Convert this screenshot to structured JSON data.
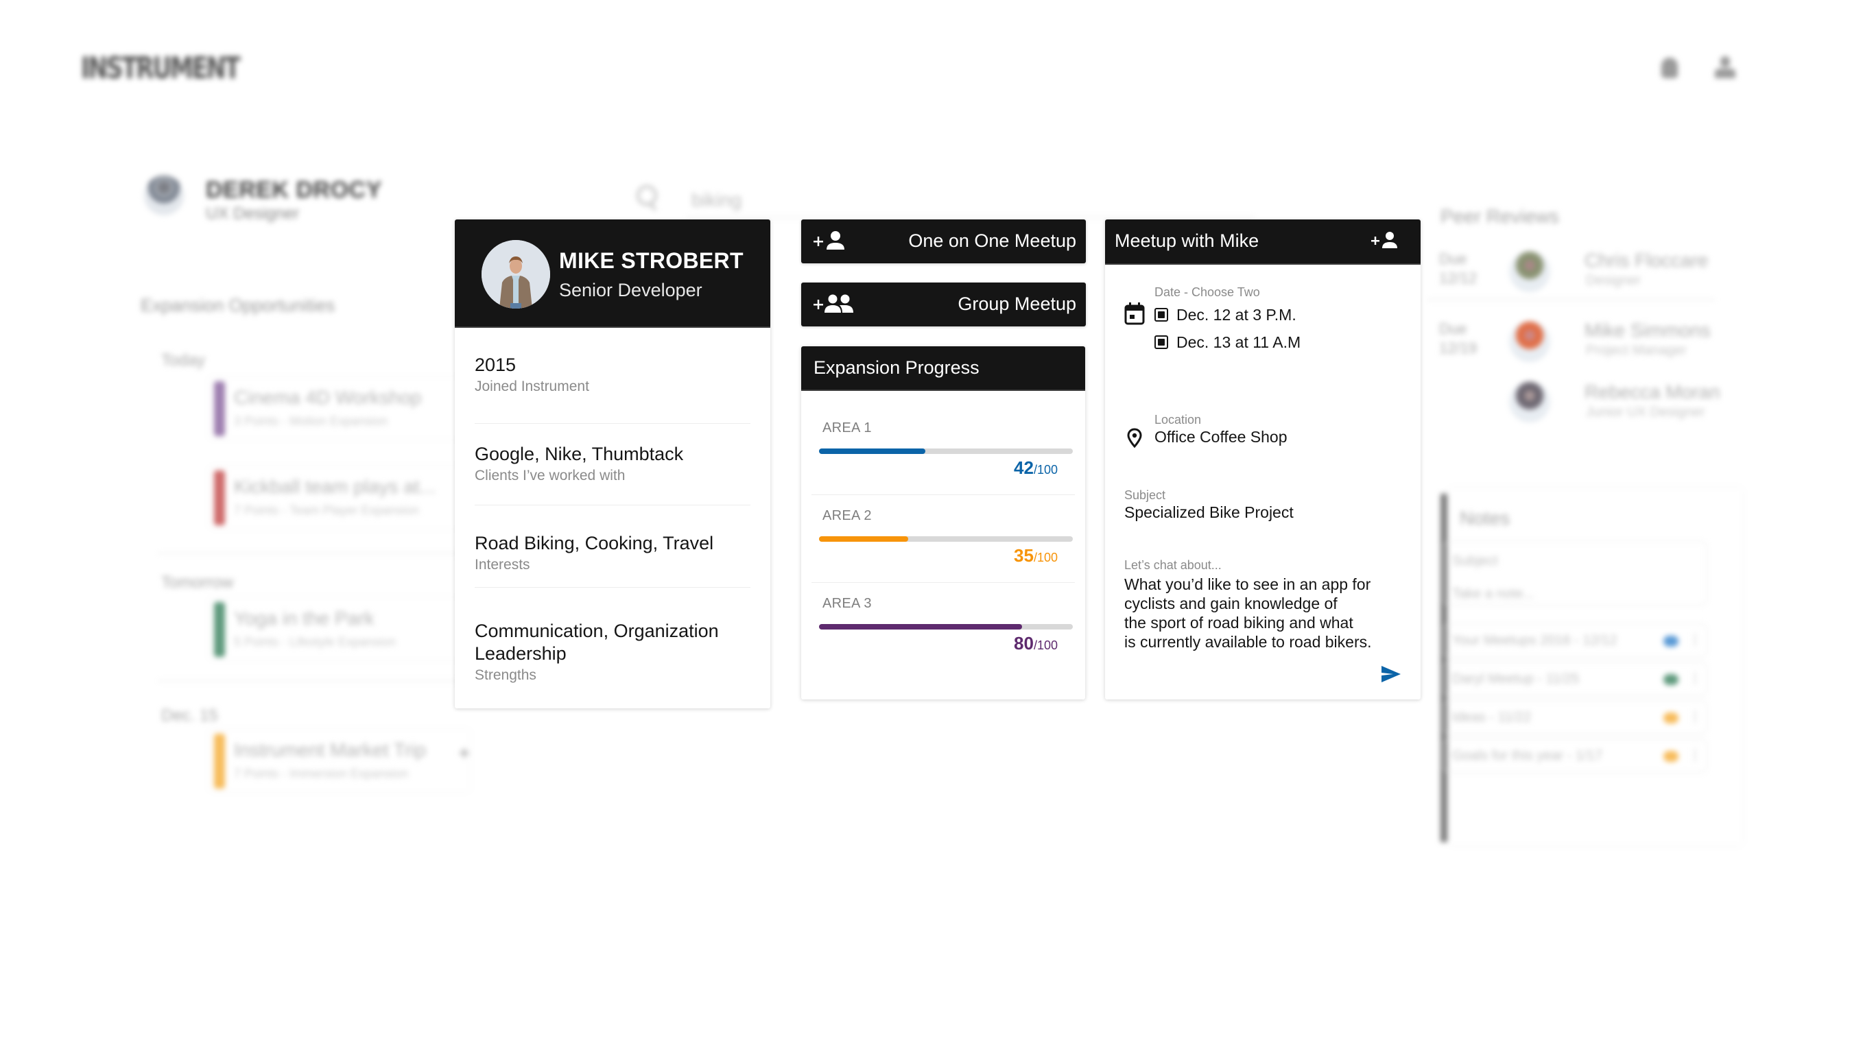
{
  "app": {
    "logo": "INSTRUMENT",
    "header_icons": [
      "bell-icon",
      "user-icon"
    ]
  },
  "current_user": {
    "name": "DEREK DROCY",
    "role": "UX Designer"
  },
  "search": {
    "value": "biking"
  },
  "expansion_opportunities": {
    "title": "Expansion Opportunities",
    "groups": [
      {
        "label": "Today",
        "items": [
          {
            "title": "Cinema 4D Workshop",
            "subtitle": "3 Points - Motion Expansion",
            "color": "#9e7fb0"
          },
          {
            "title": "Kickball team plays at...",
            "subtitle": "7 Points - Team Player Expansion",
            "color": "#cf6b6b"
          }
        ]
      },
      {
        "label": "Tomorrow",
        "items": [
          {
            "title": "Yoga in the Park",
            "subtitle": "5 Points - Lifestyle Expansion",
            "color": "#5f9a7d"
          }
        ]
      },
      {
        "label": "Dec. 15",
        "items": [
          {
            "title": "Instrument Market Trip",
            "subtitle": "7 Points - Immersion Expansion",
            "color": "#f7bc5c"
          }
        ]
      }
    ]
  },
  "profile": {
    "name": "MIKE STROBERT",
    "title": "Senior Developer",
    "items": [
      {
        "value": "2015",
        "label": "Joined Instrument"
      },
      {
        "value": "Google, Nike, Thumbtack",
        "label": "Clients I’ve worked with"
      },
      {
        "value": "Road Biking, Cooking, Travel",
        "label": "Interests"
      },
      {
        "value_lines": [
          "Communication, Organization",
          "Leadership"
        ],
        "label": "Strengths"
      }
    ]
  },
  "actions": {
    "one_on_one": "One on One Meetup",
    "group": "Group Meetup"
  },
  "expansion_progress": {
    "title": "Expansion Progress",
    "max": 100,
    "areas": [
      {
        "label": "AREA 1",
        "value": 42,
        "color": "#0b64a8"
      },
      {
        "label": "AREA 2",
        "value": 35,
        "color": "#f7940a"
      },
      {
        "label": "AREA 3",
        "value": 80,
        "color": "#5e2a6e"
      }
    ]
  },
  "meetup": {
    "title": "Meetup with Mike",
    "date_label": "Date - Choose Two",
    "date_options": [
      {
        "text": "Dec. 12 at 3 P.M.",
        "checked": true
      },
      {
        "text": "Dec. 13 at 11 A.M",
        "checked": true
      }
    ],
    "location_label": "Location",
    "location": "Office Coffee Shop",
    "subject_label": "Subject",
    "subject": "Specialized Bike Project",
    "chat_label": "Let’s chat about...",
    "chat_lines": [
      "What you’d like to see in an app for",
      "cyclists and gain knowledge of",
      "the sport of road biking and what",
      "is currently available to road bikers."
    ],
    "send_color": "#0b64a8"
  },
  "peer_reviews": {
    "title": "Peer Reviews",
    "items": [
      {
        "due": "Due",
        "date": "12/12",
        "name": "Chris Floccare",
        "role": "Designer"
      },
      {
        "due": "Due",
        "date": "12/19",
        "name": "Mike Simmons",
        "role": "Project Manager"
      },
      {
        "due": "",
        "date": "",
        "name": "Rebecca Moran",
        "role": "Junior UX Designer"
      }
    ]
  },
  "notes": {
    "title": "Notes",
    "subject_placeholder": "Subject",
    "body_placeholder": "Take a note...",
    "items": [
      {
        "label": "Your Meetups 2016 - 12/12",
        "color": "#5a9ad6"
      },
      {
        "label": "Daryl Meetup - 11/25",
        "color": "#5f9a7d"
      },
      {
        "label": "Ideas - 11/22",
        "color": "#f7bc5c"
      },
      {
        "label": "Goals for this year - 1/17",
        "color": "#f7bc5c"
      }
    ]
  }
}
